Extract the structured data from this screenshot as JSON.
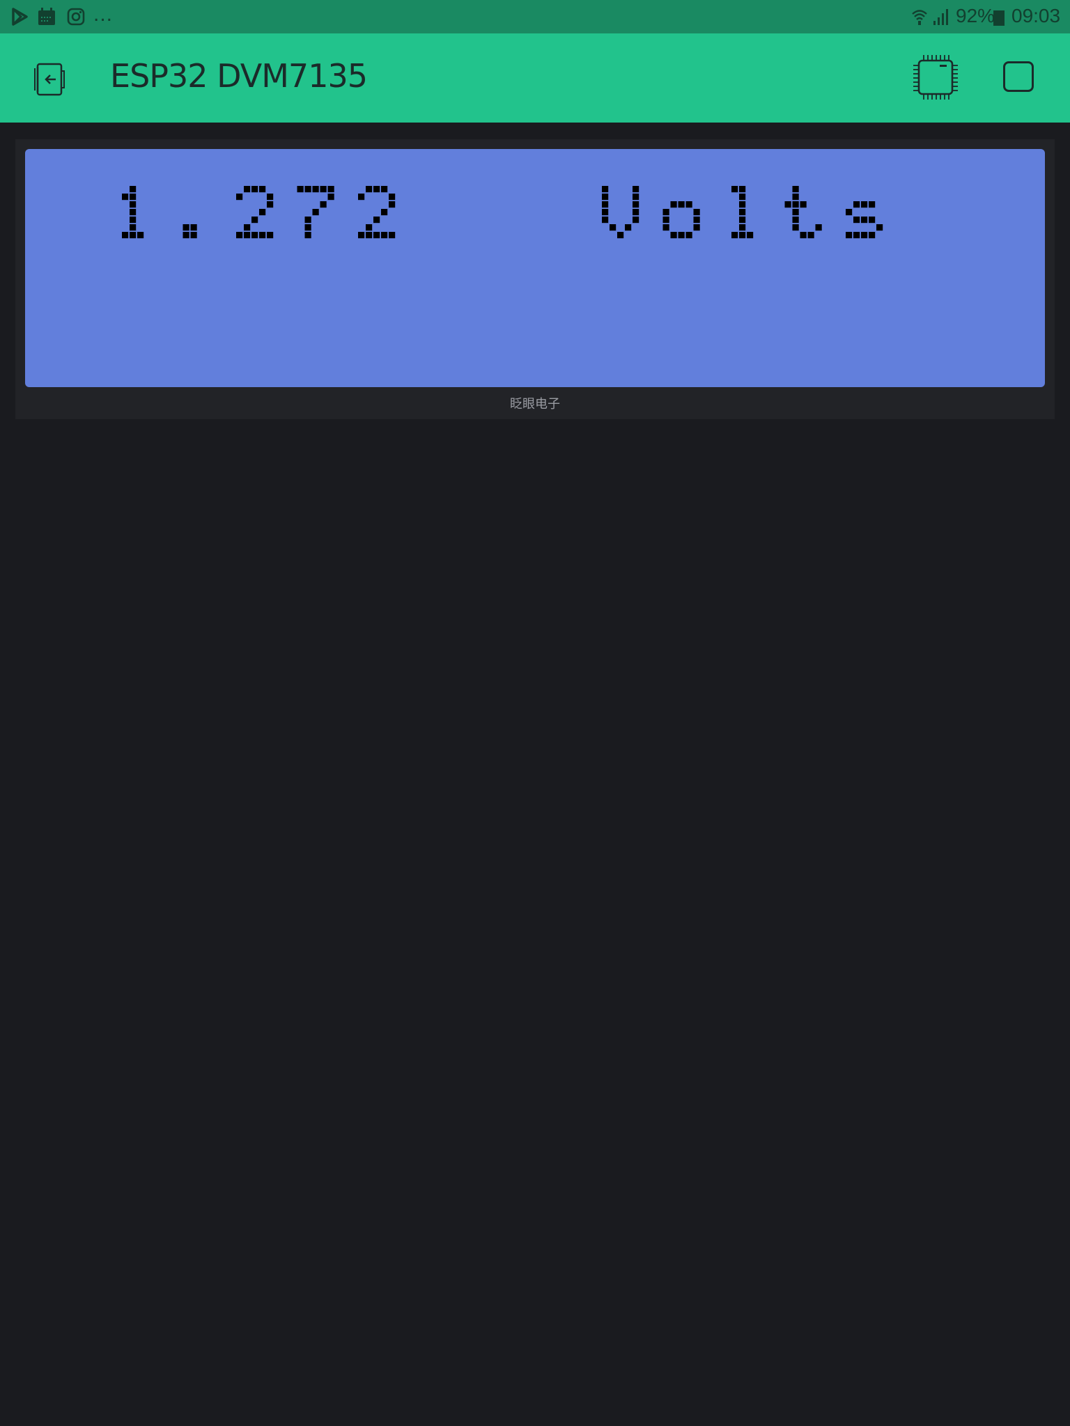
{
  "status_bar": {
    "more_indicator": "...",
    "battery_percent": "92%",
    "time": "09:03",
    "icons": [
      "play-store-icon",
      "calendar-icon",
      "instagram-icon",
      "wifi-icon",
      "signal-icon",
      "battery-icon"
    ]
  },
  "app_bar": {
    "title": "ESP32 DVM7135",
    "icons": [
      "exit-icon",
      "device-chip-icon",
      "stop-icon"
    ]
  },
  "lcd": {
    "line1_value": "1.272",
    "line1_unit": "Volts",
    "line1_full": "1.272   Volts",
    "line2": "",
    "background_color": "#627fdc",
    "pixel_color": "#000000"
  },
  "widget": {
    "label": "眨眼电子"
  },
  "colors": {
    "status_bar": "#1a8a62",
    "app_bar": "#22c38c",
    "background": "#1a1b1f",
    "widget_background": "#222327"
  }
}
